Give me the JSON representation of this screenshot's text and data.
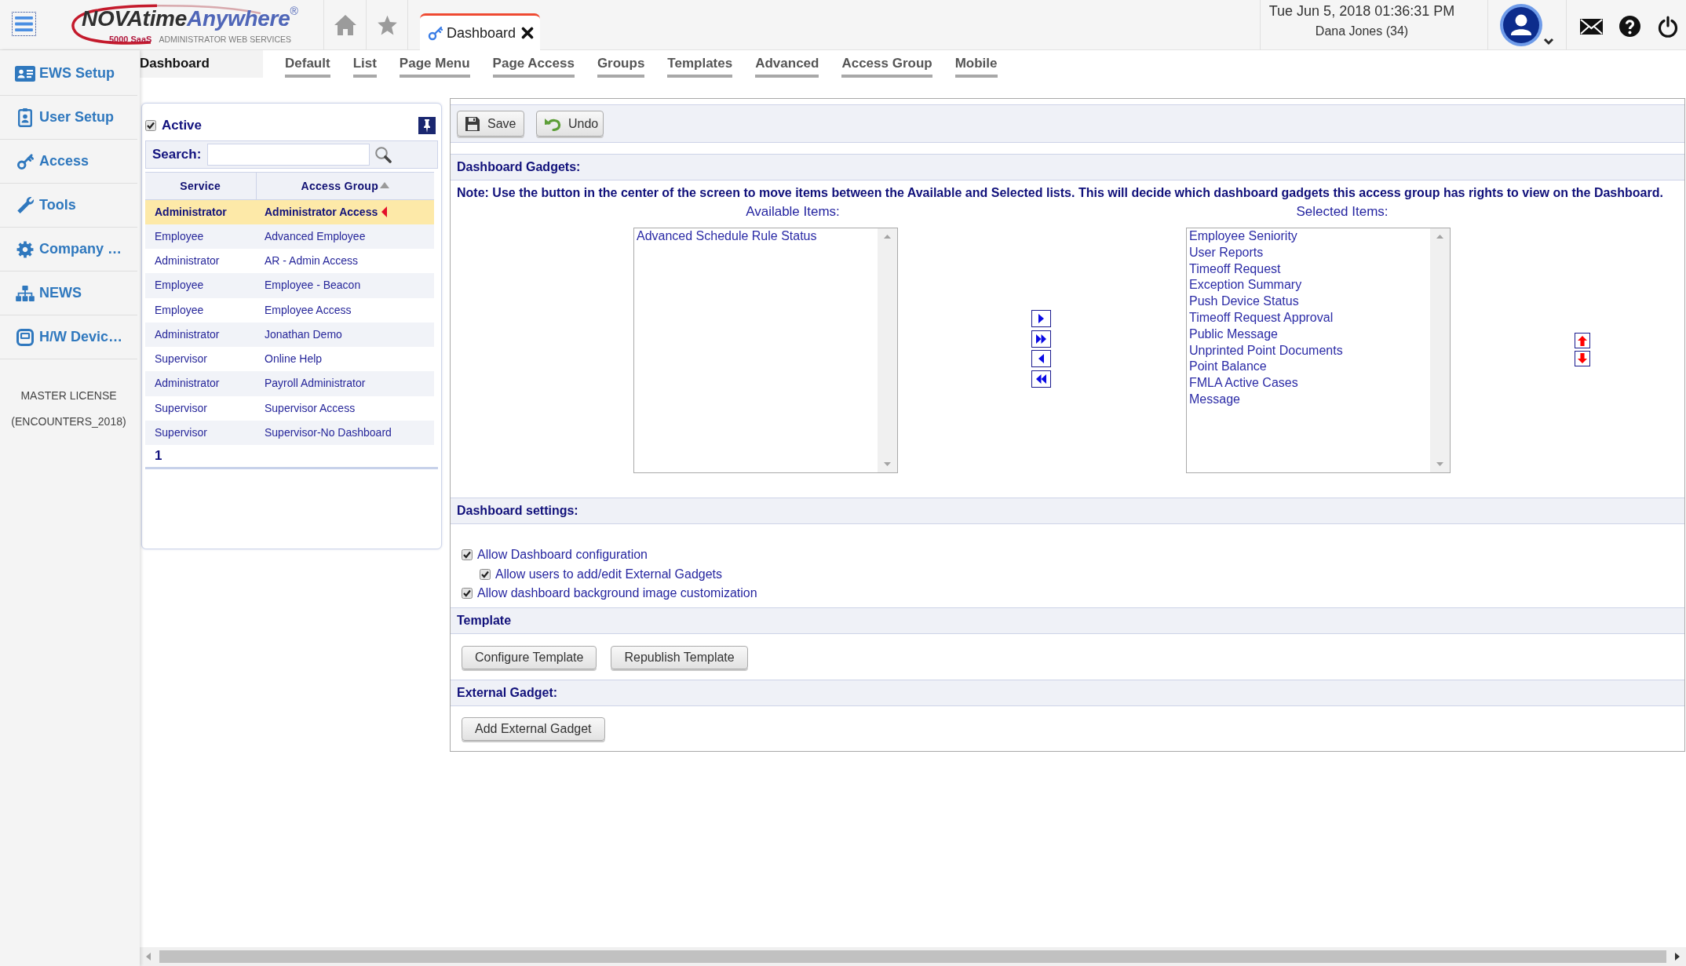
{
  "top_bar": {
    "logo": {
      "wordmark": [
        "NOVAtime",
        "Anywhere"
      ],
      "registered_mark": "®",
      "edition": "5000 SaaS",
      "tagline": "ADMINISTRATOR WEB SERVICES"
    },
    "tabs": [
      {
        "label": "Dashboard",
        "selected": true
      }
    ],
    "datetime": "Tue Jun 5, 2018 01:36:31 PM",
    "user": "Dana Jones (34)"
  },
  "sidebar": {
    "items": [
      {
        "label": "EWS Setup"
      },
      {
        "label": "User Setup"
      },
      {
        "label": "Access"
      },
      {
        "label": "Tools"
      },
      {
        "label": "Company …"
      },
      {
        "label": "NEWS"
      },
      {
        "label": "H/W Devic…"
      }
    ],
    "license": [
      "MASTER LICENSE",
      "(ENCOUNTERS_2018)"
    ]
  },
  "page_nav": {
    "title": "Dashboard",
    "tabs": [
      "Default",
      "List",
      "Page Menu",
      "Page Access",
      "Groups",
      "Templates",
      "Advanced",
      "Access Group",
      "Mobile"
    ]
  },
  "group_panel": {
    "active": {
      "label": "Active",
      "checked": true
    },
    "search": {
      "label": "Search:"
    },
    "table": {
      "columns": [
        {
          "label": "Service",
          "sorted": false
        },
        {
          "label": "Access Group",
          "sorted": true
        }
      ],
      "rows": [
        {
          "service": "Administrator",
          "access_group": "Administrator Access",
          "selected": true
        },
        {
          "service": "Employee",
          "access_group": "Advanced Employee",
          "selected": false
        },
        {
          "service": "Administrator",
          "access_group": "AR - Admin Access",
          "selected": false
        },
        {
          "service": "Employee",
          "access_group": "Employee - Beacon",
          "selected": false
        },
        {
          "service": "Employee",
          "access_group": "Employee Access",
          "selected": false
        },
        {
          "service": "Administrator",
          "access_group": "Jonathan Demo",
          "selected": false
        },
        {
          "service": "Supervisor",
          "access_group": "Online Help",
          "selected": false
        },
        {
          "service": "Administrator",
          "access_group": "Payroll Administrator",
          "selected": false
        },
        {
          "service": "Supervisor",
          "access_group": "Supervisor Access",
          "selected": false
        },
        {
          "service": "Supervisor",
          "access_group": "Supervisor-No Dashboard",
          "selected": false
        }
      ]
    },
    "pages": [
      "1"
    ]
  },
  "editor": {
    "toolbar": [
      "Save",
      "Undo"
    ],
    "gadgets": {
      "title": "Dashboard Gadgets:",
      "note": "Note: Use the button in the center of the screen to move items between the Available and Selected lists. This will decide which dashboard gadgets this access group has rights to view on the Dashboard.",
      "available": {
        "label": "Available Items:",
        "items": [
          "Advanced Schedule Rule Status"
        ]
      },
      "selected": {
        "label": "Selected Items:",
        "items": [
          "Employee Seniority",
          "User Reports",
          "Timeoff Request",
          "Exception Summary",
          "Push Device Status",
          "Timeoff Request Approval",
          "Public Message",
          "Unprinted Point Documents",
          "Point Balance",
          "FMLA Active Cases",
          "Message"
        ]
      }
    },
    "settings": {
      "title": "Dashboard settings:",
      "options": [
        {
          "label": "Allow Dashboard configuration",
          "checked": true,
          "children": [
            {
              "label": "Allow users to add/edit External Gadgets",
              "checked": true
            }
          ]
        },
        {
          "label": "Allow dashboard background image customization",
          "checked": true
        }
      ]
    },
    "template": {
      "title": "Template",
      "buttons": [
        "Configure Template",
        "Republish Template"
      ]
    },
    "external_gadget": {
      "title": "External Gadget:",
      "buttons": [
        "Add External Gadget"
      ]
    }
  }
}
